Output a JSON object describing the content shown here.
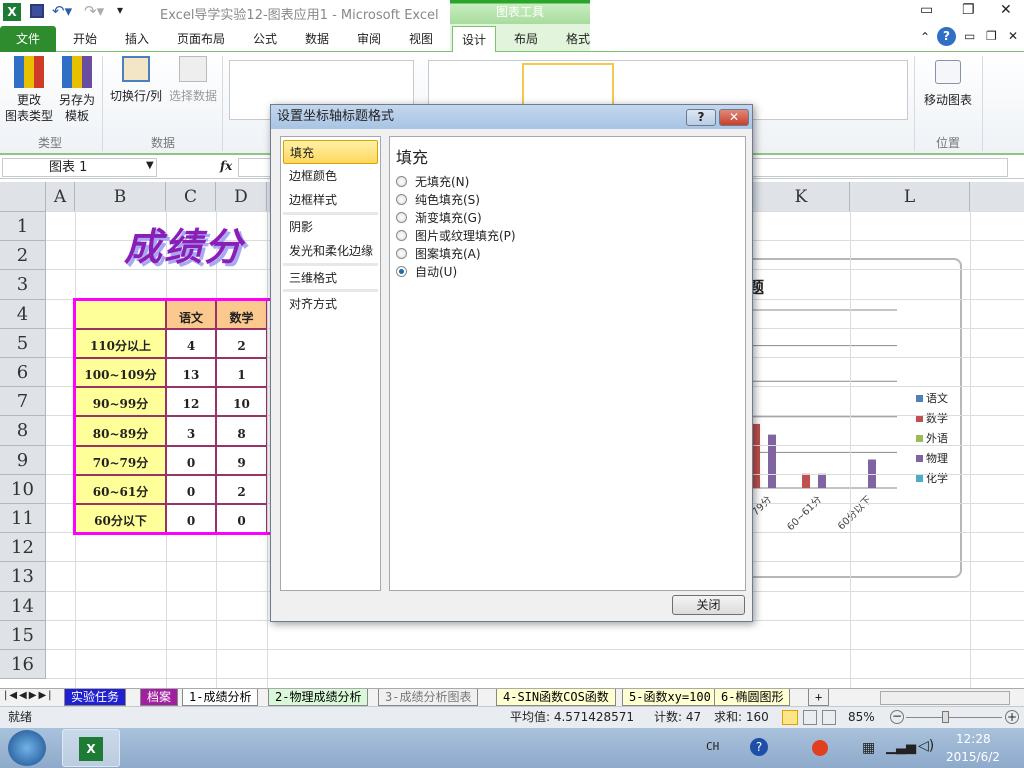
{
  "window": {
    "title": "Excel导学实验12-图表应用1  -  Microsoft Excel",
    "context_tools": "图表工具"
  },
  "tabs": [
    "文件",
    "开始",
    "插入",
    "页面布局",
    "公式",
    "数据",
    "审阅",
    "视图",
    "设计",
    "布局",
    "格式"
  ],
  "ribbon": {
    "change_type_1": "更改",
    "change_type_2": "图表类型",
    "save_tpl_1": "另存为",
    "save_tpl_2": "模板",
    "group_type": "类型",
    "switch": "切换行/列",
    "select_data": "选择数据",
    "group_data": "数据",
    "move_chart": "移动图表",
    "group_location": "位置"
  },
  "formula": {
    "name_box": "图表 1",
    "fx": "fx"
  },
  "columns": [
    "A",
    "B",
    "C",
    "D",
    "K",
    "L"
  ],
  "rows": [
    "1",
    "2",
    "3",
    "4",
    "5",
    "6",
    "7",
    "8",
    "9",
    "10",
    "11",
    "12",
    "13",
    "14",
    "15",
    "16"
  ],
  "sheet_title": "成绩分",
  "table": {
    "headers": [
      "",
      "语文",
      "数学"
    ],
    "rows": [
      [
        "110分以上",
        "4",
        "2"
      ],
      [
        "100~109分",
        "13",
        "1"
      ],
      [
        "90~99分",
        "12",
        "10"
      ],
      [
        "80~89分",
        "3",
        "8"
      ],
      [
        "70~79分",
        "0",
        "9"
      ],
      [
        "60~61分",
        "0",
        "2"
      ],
      [
        "60分以下",
        "0",
        "0"
      ]
    ]
  },
  "dialog": {
    "title": "设置坐标轴标题格式",
    "help": "?",
    "close_x": "✕",
    "nav": [
      "填充",
      "边框颜色",
      "边框样式",
      "阴影",
      "发光和柔化边缘",
      "三维格式",
      "对齐方式"
    ],
    "heading": "填充",
    "options": [
      "无填充(N)",
      "纯色填充(S)",
      "渐变填充(G)",
      "图片或纹理填充(P)",
      "图案填充(A)",
      "自动(U)"
    ],
    "selected": 5,
    "close_button": "关闭"
  },
  "chart_data": {
    "type": "bar",
    "title_partial": "题",
    "categories": [
      "70~79分",
      "60~61分",
      "60分以下"
    ],
    "series": [
      {
        "name": "语文",
        "color": "#4f81bd",
        "values": [
          0,
          0,
          0
        ]
      },
      {
        "name": "数学",
        "color": "#c0504d",
        "values": [
          9,
          2,
          0
        ]
      },
      {
        "name": "外语",
        "color": "#9bbb59",
        "values": [
          0,
          0,
          0
        ]
      },
      {
        "name": "物理",
        "color": "#8064a2",
        "values": [
          7.5,
          2,
          4
        ]
      },
      {
        "name": "化学",
        "color": "#4bacc6",
        "values": [
          0,
          0,
          0
        ]
      }
    ],
    "ymax_visible": 25
  },
  "sheet_tabs": [
    "实验任务",
    "档案",
    "1-成绩分析",
    "2-物理成绩分析",
    "3-成绩分析图表",
    "4-SIN函数COS函数",
    "5-函数xy=100",
    "6-椭圆图形"
  ],
  "status": {
    "ready": "就绪",
    "average": "平均值: 4.571428571",
    "count": "计数: 47",
    "sum": "求和: 160",
    "zoom": "85%"
  },
  "taskbar": {
    "lang": "CH",
    "time": "12:28",
    "date": "2015/6/2"
  }
}
